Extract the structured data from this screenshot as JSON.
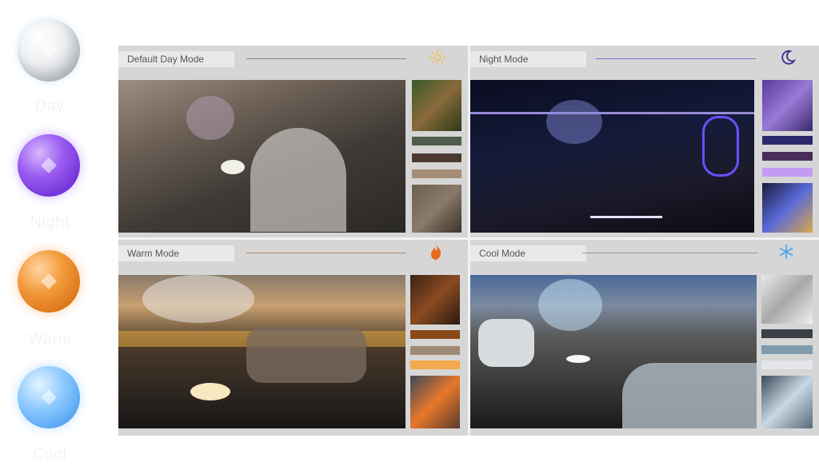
{
  "modes": [
    {
      "orb_label": "Day",
      "panel_label": "Default Day Mode",
      "icon": "sun-icon",
      "accent": "#f0c050",
      "swatches": [
        "#4e5e4a",
        "#4b3a30",
        "#a58c76"
      ]
    },
    {
      "orb_label": "Night",
      "panel_label": "Night Mode",
      "icon": "moon-icon",
      "accent": "#3a2a8c",
      "swatches": [
        "#2c2a6e",
        "#4a2c5a",
        "#c49af2"
      ]
    },
    {
      "orb_label": "Warm",
      "panel_label": "Warm Mode",
      "icon": "flame-icon",
      "accent": "#e46a1c",
      "swatches": [
        "#8a4a18",
        "#a08a78",
        "#f2a84c"
      ]
    },
    {
      "orb_label": "Cool",
      "panel_label": "Cool Mode",
      "icon": "snowflake-icon",
      "accent": "#4aa0e8",
      "swatches": [
        "#3a4048",
        "#7e9cac",
        "#e4e6ea"
      ]
    }
  ]
}
